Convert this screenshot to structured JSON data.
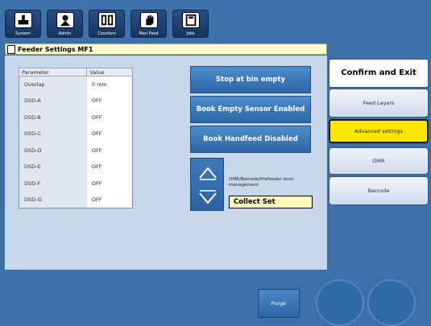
{
  "toolbar": {
    "items": [
      {
        "label": "System",
        "icon": "system-icon"
      },
      {
        "label": "Admin",
        "icon": "admin-icon"
      },
      {
        "label": "Counters",
        "icon": "counters-icon"
      },
      {
        "label": "Man Feed",
        "icon": "hand-icon"
      },
      {
        "label": "Jobs",
        "icon": "jobs-icon"
      }
    ]
  },
  "header": {
    "title": "Feeder Settings MF1",
    "icon": "document-icon"
  },
  "table": {
    "headers": [
      "Parameter",
      "Value"
    ],
    "rows": [
      {
        "param": "Overlap",
        "value": "0 mm"
      },
      {
        "param": "DSD-A",
        "value": "OFF"
      },
      {
        "param": "DSD-B",
        "value": "OFF"
      },
      {
        "param": "DSD-C",
        "value": "OFF"
      },
      {
        "param": "DSD-D",
        "value": "OFF"
      },
      {
        "param": "DSD-E",
        "value": "OFF"
      },
      {
        "param": "DSD-F",
        "value": "OFF"
      },
      {
        "param": "DSD-G",
        "value": "OFF"
      }
    ]
  },
  "actions": {
    "stop_at_bin_empty": "Stop at bin empty",
    "book_empty_sensor": "Book Empty Sensor Enabled",
    "book_handfeed": "Book Handfeed Disabled"
  },
  "omr": {
    "label": "OMR/Barcode/Prefeeder error management",
    "value": "Collect Set"
  },
  "sidebar": {
    "confirm": "Confirm and Exit",
    "feed_layers": "Feed Layers",
    "advanced": "Advanced settings",
    "omr": "OMR",
    "barcode": "Barcode"
  },
  "bottom": {
    "purge": "Purge"
  },
  "colors": {
    "active_highlight": "#ffe600",
    "header_bg": "#fffbd0",
    "panel_bg": "#c8d7ea",
    "button_blue": "#2e67a6"
  }
}
